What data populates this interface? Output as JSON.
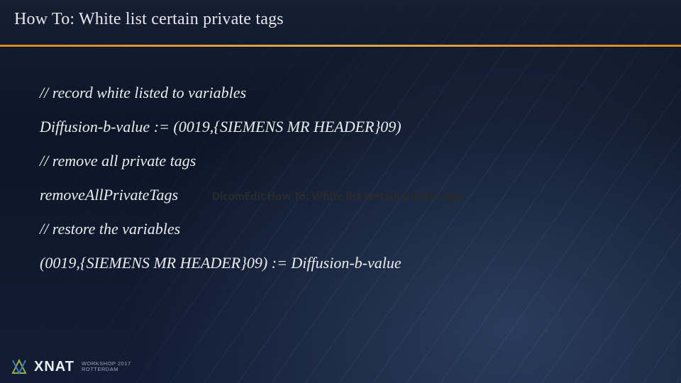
{
  "header": {
    "title": "How To: White list certain private tags"
  },
  "code": {
    "line1": "// record white listed to variables",
    "line2": "Diffusion-b-value := (0019,{SIEMENS MR HEADER}09)",
    "line3": "// remove all private tags",
    "line4": "removeAllPrivateTags",
    "annotation": "DicomEdit How To: White list certain private tags",
    "line5": "// restore the variables",
    "line6": "(0019,{SIEMENS MR HEADER}09) := Diffusion-b-value"
  },
  "footer": {
    "brand": "XNAT",
    "sub1": "WORKSHOP 2017",
    "sub2": "ROTTERDAM"
  }
}
